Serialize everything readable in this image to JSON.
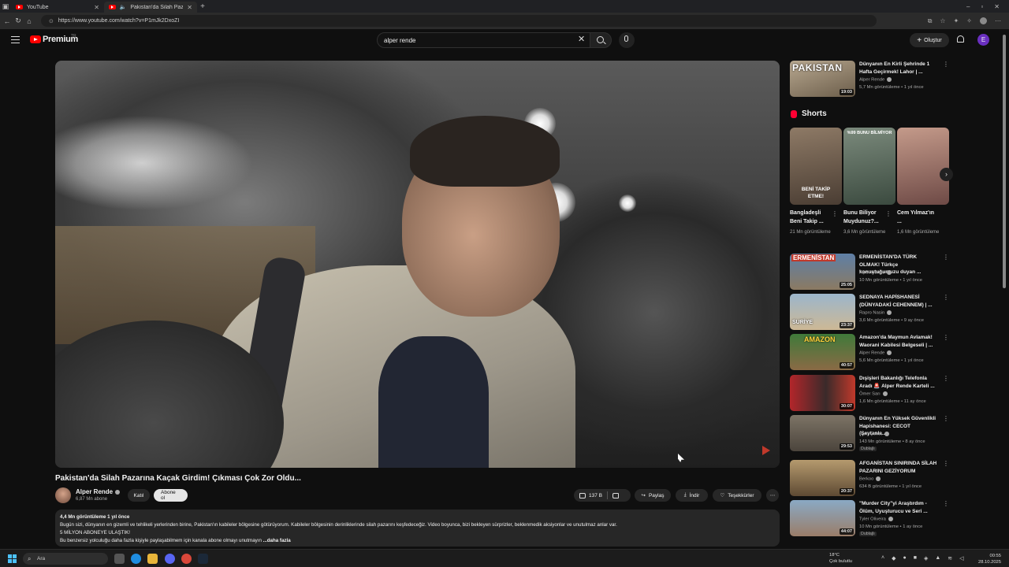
{
  "browser": {
    "tabs": [
      {
        "label": "YouTube"
      },
      {
        "label": "Pakistan'da Silah Pazarına K..."
      }
    ],
    "url": "https://www.youtube.com/watch?v=P1mJk2DxoZI"
  },
  "masthead": {
    "logo": "Premium",
    "logo_region": "TR",
    "search_value": "alper rende",
    "create_label": "Oluştur",
    "avatar_letter": "E"
  },
  "video": {
    "title": "Pakistan'da Silah Pazarına Kaçak Girdim! Çıkması Çok Zor Oldu...",
    "channel": "Alper Rende",
    "subscribers": "6,87 Mn abone",
    "join_label": "Katıl",
    "subscribe_label": "Abone ol",
    "likes": "137 B",
    "share_label": "Paylaş",
    "download_label": "İndir",
    "thanks_label": "Teşekkürler",
    "description": {
      "stats": "4,4 Mn görüntüleme  1 yıl önce",
      "line1": "Bugün sizi, dünyanın en gizemli ve tehlikeli yerlerinden birine, Pakistan'ın kabileler bölgesine götürüyorum. Kabileler bölgesinin derinliklerinde silah pazarını keşfedeceğiz. Video boyunca, bizi bekleyen sürprizler, beklenmedik aksiyonlar ve unutulmaz anlar var.",
      "line2": "5 MİLYON ABONEYE ULAŞTIK!",
      "line3": "Bu benzersiz yolculuğu daha fazla kişiyle paylaşabilmem için kanala abone olmayı unutmayın ",
      "more": "...daha fazla"
    }
  },
  "sidebar": {
    "top_item": {
      "title": "Dünyanın En Kirli Şehrinde 1 Hafta Geçirmek! Lahor | ...",
      "channel": "Alper Rende",
      "meta": "5,7 Mn görüntüleme • 1 yıl önce",
      "duration": "19:03",
      "thumb_text": "PAKISTAN"
    },
    "shorts_label": "Shorts",
    "shorts": [
      {
        "title": "Bangladeşli Beni Takip ...",
        "views": "21 Mn görüntüleme",
        "overlay": "BENİ TAKİP ETME!"
      },
      {
        "title": "Bunu Biliyor Muydunuz?...",
        "views": "3,6 Mn görüntüleme",
        "overlay": "%99 BUNU BİLMİYOR"
      },
      {
        "title": "Cem Yılmaz'ın ...",
        "views": "1,6 Mn görüntüleme",
        "overlay": ""
      }
    ],
    "videos": [
      {
        "title": "ERMENİSTAN'DA TÜRK OLMAK! Türkçe konuştuğumuzu duyan ...",
        "channel": "Alper Rende",
        "meta": "10 Mn görüntüleme • 1 yıl önce",
        "duration": "25:05",
        "badge": "",
        "thumb_text": "ERMENİSTAN"
      },
      {
        "title": "SEDNAYA HAPİSHANESİ (DÜNYADAKİ CEHENNEM) | ...",
        "channel": "Rapro Nasin",
        "meta": "3,6 Mn görüntüleme • 9 ay önce",
        "duration": "23:37",
        "badge": "",
        "thumb_text": "SURİYE"
      },
      {
        "title": "Amazon'da Maymun Avlamak! Waorani Kabilesi Belgeseli | ...",
        "channel": "Alper Rende",
        "meta": "5,6 Mn görüntüleme • 1 yıl önce",
        "duration": "40:57",
        "badge": "",
        "thumb_text": "AMAZON"
      },
      {
        "title": "Dışişleri Bakanlığı Telefonla Aradı 🚨 Alper Rende Karteli ...",
        "channel": "Ömer Sarı",
        "meta": "1,6 Mn görüntüleme • 11 ay önce",
        "duration": "30:07",
        "badge": "",
        "thumb_text": ""
      },
      {
        "title": "Dünyanın En Yüksek Güvenlikli Hapishanesi: CECOT (Şeytanla...",
        "channel": "Ruhi Çenet",
        "meta": "143 Mn görüntüleme • 8 ay önce",
        "duration": "29:53",
        "badge": "Dublajlı",
        "thumb_text": ""
      },
      {
        "title": "AFGANİSTAN SINIRINDA SİLAH PAZARINI GEZİYORUM",
        "channel": "Berkoo",
        "meta": "634 B görüntüleme • 1 yıl önce",
        "duration": "20:37",
        "badge": "",
        "thumb_text": ""
      },
      {
        "title": "\"Murder City\"yi Araştırdım - Ölüm, Uyuşturucu ve Seri ...",
        "channel": "Tyler Oliveira",
        "meta": "10 Mn görüntüleme • 1 ay önce",
        "duration": "44:07",
        "badge": "Dublajlı",
        "thumb_text": ""
      }
    ]
  },
  "taskbar": {
    "search_placeholder": "Ara",
    "weather_temp": "18°C",
    "weather_desc": "Çok bulutlu",
    "time": "00:55",
    "date": "28.10.2025"
  },
  "colors": {
    "accent": "#ff0000",
    "subscribe_bg": "#e5e5e5",
    "avatar": "#6a2fc0"
  }
}
